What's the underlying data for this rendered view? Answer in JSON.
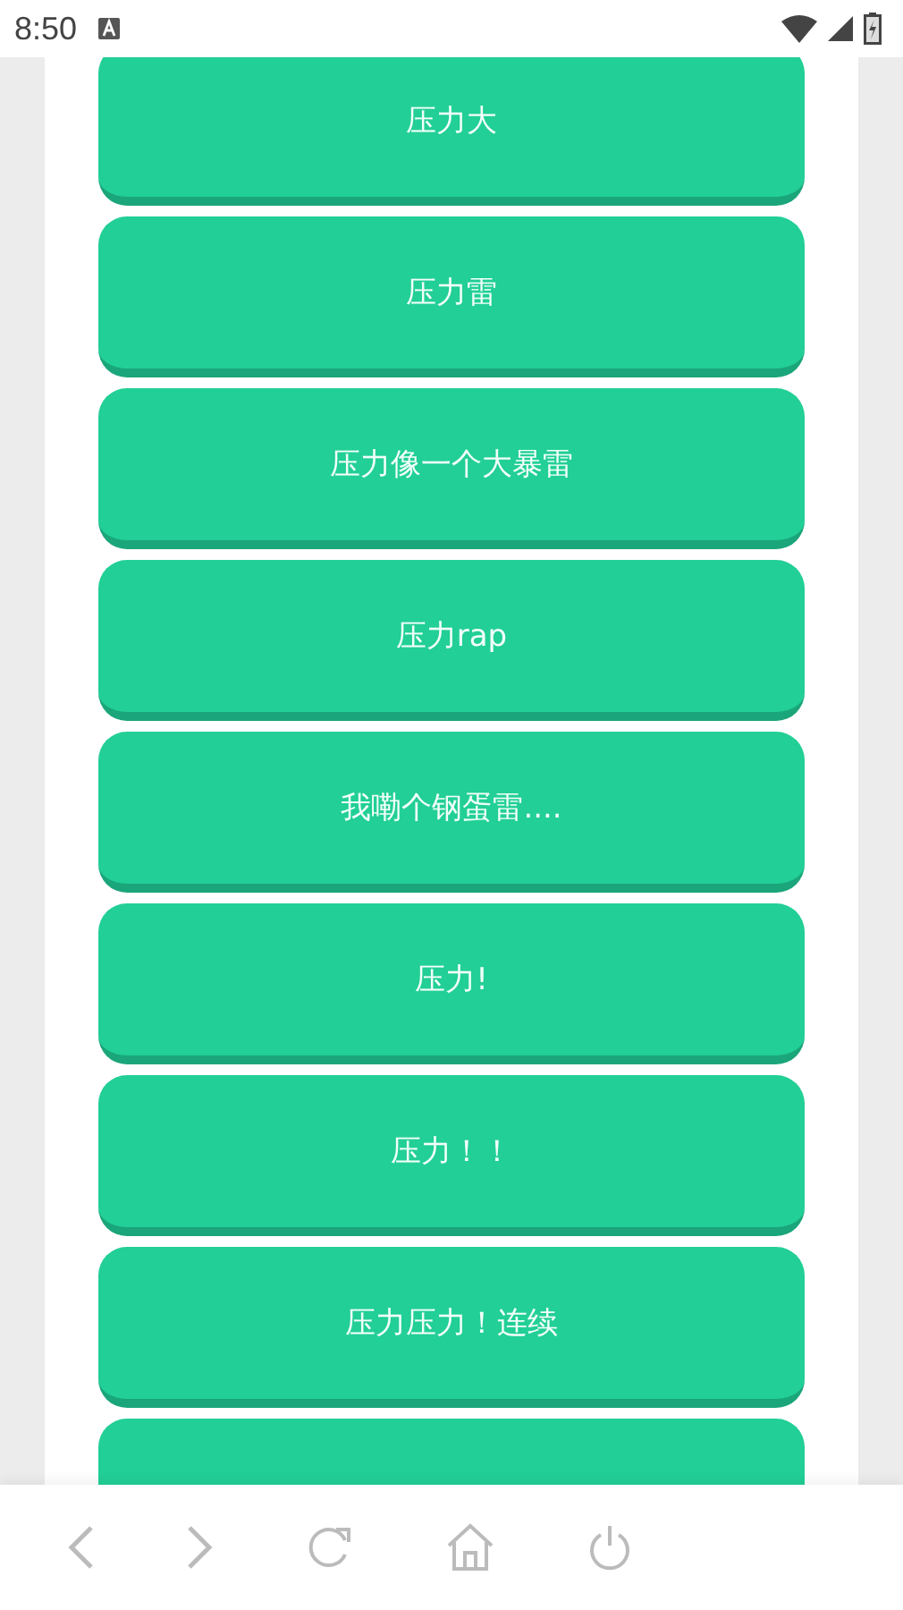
{
  "status_bar": {
    "time": "8:50"
  },
  "buttons": [
    "压力大",
    "压力雷",
    "压力像一个大暴雷",
    "压力rap",
    "我嘞个钢蛋雷....",
    "压力!",
    "压力！！",
    "压力压力！连续"
  ],
  "more_button_cut_off": true
}
